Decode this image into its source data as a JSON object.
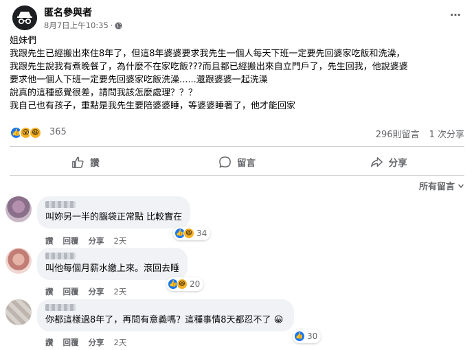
{
  "post": {
    "author": "匿名參與者",
    "timestamp": "8月7日上午10:35",
    "separator": "·",
    "more_icon": "⋯",
    "lines": [
      "姐妹們",
      "我跟先生已經搬出來住8年了，但這8年婆婆要求我先生一個人每天下班一定要先回婆家吃飯和洗澡，",
      "我跟先生說我有煮晚餐了，為什麼不在家吃飯???而且都已經搬出來自立門戶了，先生回我，他說婆婆",
      "要求他一個人下班一定要先回婆家吃飯洗澡......還跟婆婆一起洗澡",
      "說真的這種感覺很差，請問我該怎麼處理？？？",
      "我自己也有孩子，重點是我先生要陪婆婆睡，等婆婆睡著了，他才能回家"
    ],
    "reaction_count": "365",
    "comment_count": "296則留言",
    "share_count": "1 次分享"
  },
  "actions": {
    "like": "讚",
    "comment": "留言",
    "share": "分享"
  },
  "sort_label": "所有留言",
  "comments": [
    {
      "text": "叫妳另一半的腦袋正常點 比較實在",
      "like": "讚",
      "reply": "回覆",
      "share": "分享",
      "time": "2天",
      "reactions": "34"
    },
    {
      "text": "叫他每個月薪水繳上來。滾回去睡",
      "like": "讚",
      "reply": "回覆",
      "share": "分享",
      "time": "2天",
      "reactions": "20"
    },
    {
      "text": "你都這樣過8年了，再問有意義嗎？這種事情8天都忍不了",
      "like": "讚",
      "reply": "回覆",
      "share": "分享",
      "time": "2天",
      "reactions": "30"
    }
  ],
  "colors": {
    "accent": "#1877f2",
    "muted": "#65676b",
    "bubble": "#f0f2f5",
    "emoji": "#f7b125"
  }
}
